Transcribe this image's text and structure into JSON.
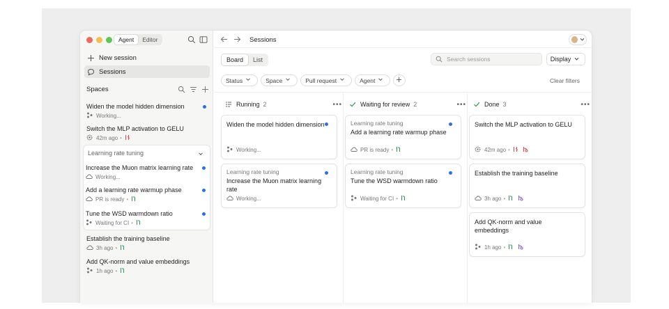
{
  "colors": {
    "blue_dot": "#2f6fe4",
    "pr_green": "#2e9a58",
    "pr_red": "#d94b4b",
    "pr_purple": "#8a5cd6"
  },
  "sidebar": {
    "mode_toggle": [
      "Agent",
      "Editor"
    ],
    "new_session_label": "New session",
    "sessions_label": "Sessions",
    "spaces_label": "Spaces",
    "items": [
      {
        "title": "Widen the model hidden dimension",
        "status": "Working...",
        "status_icon": "agent-icon",
        "pr_icon": "",
        "unread": true
      },
      {
        "title": "Switch the MLP activation to GELU",
        "status": "42m ago",
        "status_icon": "gear-icon",
        "pr_icon": "pr-closed-icon",
        "unread": false
      }
    ],
    "group": {
      "title": "Learning rate tuning",
      "items": [
        {
          "title": "Increase the Muon matrix learning rate",
          "status": "Working...",
          "status_icon": "cloud-icon",
          "pr_icon": "",
          "unread": true
        },
        {
          "title": "Add a learning rate warmup phase",
          "status": "PR is ready",
          "status_icon": "cloud-icon",
          "pr_icon": "pr-open-icon",
          "unread": true
        },
        {
          "title": "Tune the WSD warmdown ratio",
          "status": "Waiting for CI",
          "status_icon": "agent-icon",
          "pr_icon": "pr-open-icon",
          "unread": true
        }
      ]
    },
    "items_after": [
      {
        "title": "Establish the training baseline",
        "status": "3h ago",
        "status_icon": "cloud-icon",
        "pr_icon": "pr-open-icon",
        "unread": false
      },
      {
        "title": "Add QK-norm and value embeddings",
        "status": "1h ago",
        "status_icon": "agent-icon",
        "pr_icon": "pr-open-icon",
        "unread": false
      }
    ]
  },
  "header": {
    "breadcrumb": "Sessions"
  },
  "toolbar": {
    "view_tabs": [
      "Board",
      "List"
    ],
    "search_placeholder": "Search sessions",
    "display_label": "Display",
    "filters": [
      "Status",
      "Space",
      "Pull request",
      "Agent"
    ],
    "clear_filters": "Clear filters"
  },
  "board": {
    "columns": [
      {
        "title": "Running",
        "count": "2",
        "icon": "running-list-icon",
        "cards": [
          {
            "space": "",
            "title": "Widen the model hidden dimension",
            "status": "Working...",
            "status_icon": "agent-icon",
            "unread": true,
            "pr_icons": []
          },
          {
            "space": "Learning rate tuning",
            "title": "Increase the Muon matrix learning rate",
            "status": "Working...",
            "status_icon": "cloud-icon",
            "unread": true,
            "pr_icons": []
          }
        ]
      },
      {
        "title": "Waiting for review",
        "count": "2",
        "icon": "check-icon",
        "cards": [
          {
            "space": "Learning rate tuning",
            "title": "Add a learning rate warmup phase",
            "status": "PR is ready",
            "status_icon": "cloud-icon",
            "unread": true,
            "pr_icons": [
              "pr-open-icon"
            ]
          },
          {
            "space": "Learning rate tuning",
            "title": "Tune the WSD warmdown ratio",
            "status": "Waiting for CI",
            "status_icon": "agent-icon",
            "unread": true,
            "pr_icons": [
              "pr-open-icon"
            ]
          }
        ]
      },
      {
        "title": "Done",
        "count": "3",
        "icon": "check-icon",
        "cards": [
          {
            "space": "",
            "title": "Switch the MLP activation to GELU",
            "status": "42m ago",
            "status_icon": "gear-icon",
            "unread": false,
            "pr_icons": [
              "pr-closed-icon",
              "branch-red-icon"
            ]
          },
          {
            "space": "",
            "title": "Establish the training baseline",
            "status": "3h ago",
            "status_icon": "cloud-icon",
            "unread": false,
            "pr_icons": [
              "pr-open-icon",
              "branch-purple-icon"
            ]
          },
          {
            "space": "",
            "title": "Add QK-norm and value embeddings",
            "status": "1h ago",
            "status_icon": "agent-icon",
            "unread": false,
            "pr_icons": [
              "pr-open-icon",
              "branch-purple-icon"
            ]
          }
        ]
      }
    ]
  }
}
